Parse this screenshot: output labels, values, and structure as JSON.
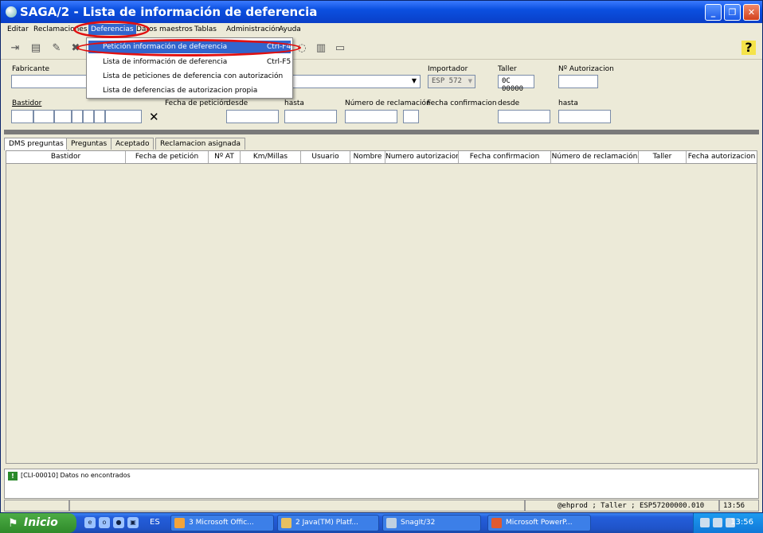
{
  "window": {
    "title": "SAGA/2 - Lista de información de deferencia"
  },
  "menu": {
    "items": [
      "Editar",
      "Reclamaciones",
      "Deferencias",
      "Datos maestros",
      "Tablas",
      "Administración",
      "Ayuda"
    ],
    "dropdown": [
      {
        "label": "Petición información de deferencia",
        "shortcut": "Ctrl-F4"
      },
      {
        "label": "Lista de información de deferencia",
        "shortcut": "Ctrl-F5"
      },
      {
        "label": "Lista de peticiones de deferencia con autorización",
        "shortcut": ""
      },
      {
        "label": "Lista de deferencias de autorizacion propia",
        "shortcut": ""
      }
    ]
  },
  "toolbar": {
    "help": "?"
  },
  "form": {
    "fabricante_label": "Fabricante",
    "importador_label": "Importador",
    "importador_value": "ESP 572",
    "taller_label": "Taller",
    "taller_value": "0C 00000",
    "autorizacion_label": "Nº Autorizacion",
    "bastidor_label": "Bastidor",
    "fecha_peticion_label": "Fecha de petición",
    "desde_label": "desde",
    "hasta_label": "hasta",
    "num_reclamacion_label": "Número de reclamación",
    "fecha_confirmacion_label": "Fecha confirmacion",
    "desde2_label": "desde",
    "hasta2_label": "hasta"
  },
  "tabs": [
    "DMS preguntas",
    "Preguntas",
    "Aceptado",
    "Reclamacion asignada"
  ],
  "grid": {
    "columns": [
      "Bastidor",
      "Fecha de petición",
      "Nº AT",
      "Km/Millas",
      "Usuario",
      "Nombre",
      "Numero autorizacion",
      "Fecha confirmacion",
      "Número de reclamación",
      "Taller",
      "Fecha autorizacion"
    ]
  },
  "message": {
    "text": "[CLI-00010] Datos no encontrados"
  },
  "status": {
    "info": "@ehprod ; Taller ; ESP57200000.010",
    "time": "13:56"
  },
  "taskbar": {
    "start": "Inicio",
    "lang": "ES",
    "buttons": [
      "3 Microsoft Offic...",
      "2 Java(TM) Platf...",
      "SnagIt/32",
      "Microsoft PowerP..."
    ],
    "clock": "13:56"
  }
}
